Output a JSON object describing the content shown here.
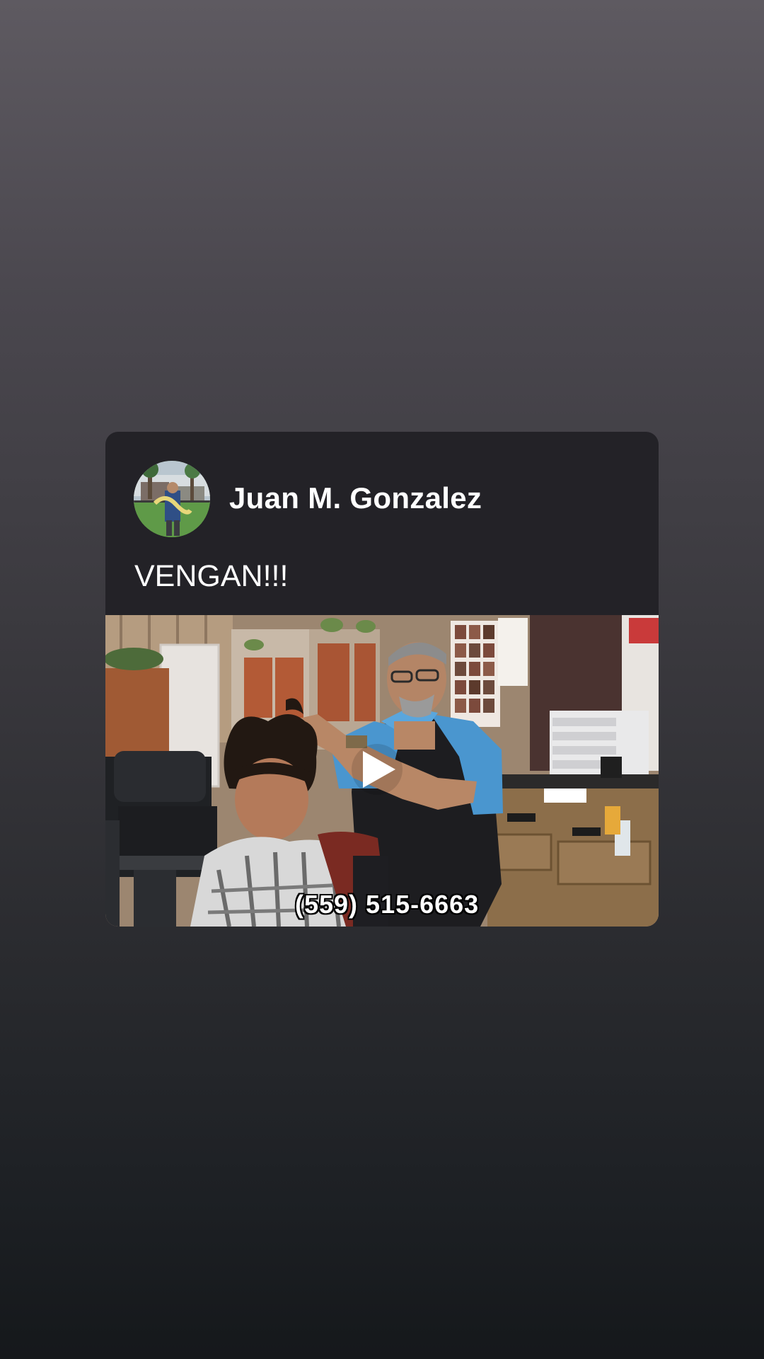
{
  "post": {
    "author": "Juan M. Gonzalez",
    "text": "VENGAN!!!",
    "avatar_icon": "profile-photo",
    "video": {
      "caption": "(559) 515-6663",
      "play_icon": "play-icon"
    }
  },
  "colors": {
    "card_background": "#232227",
    "text": "#ffffff"
  }
}
